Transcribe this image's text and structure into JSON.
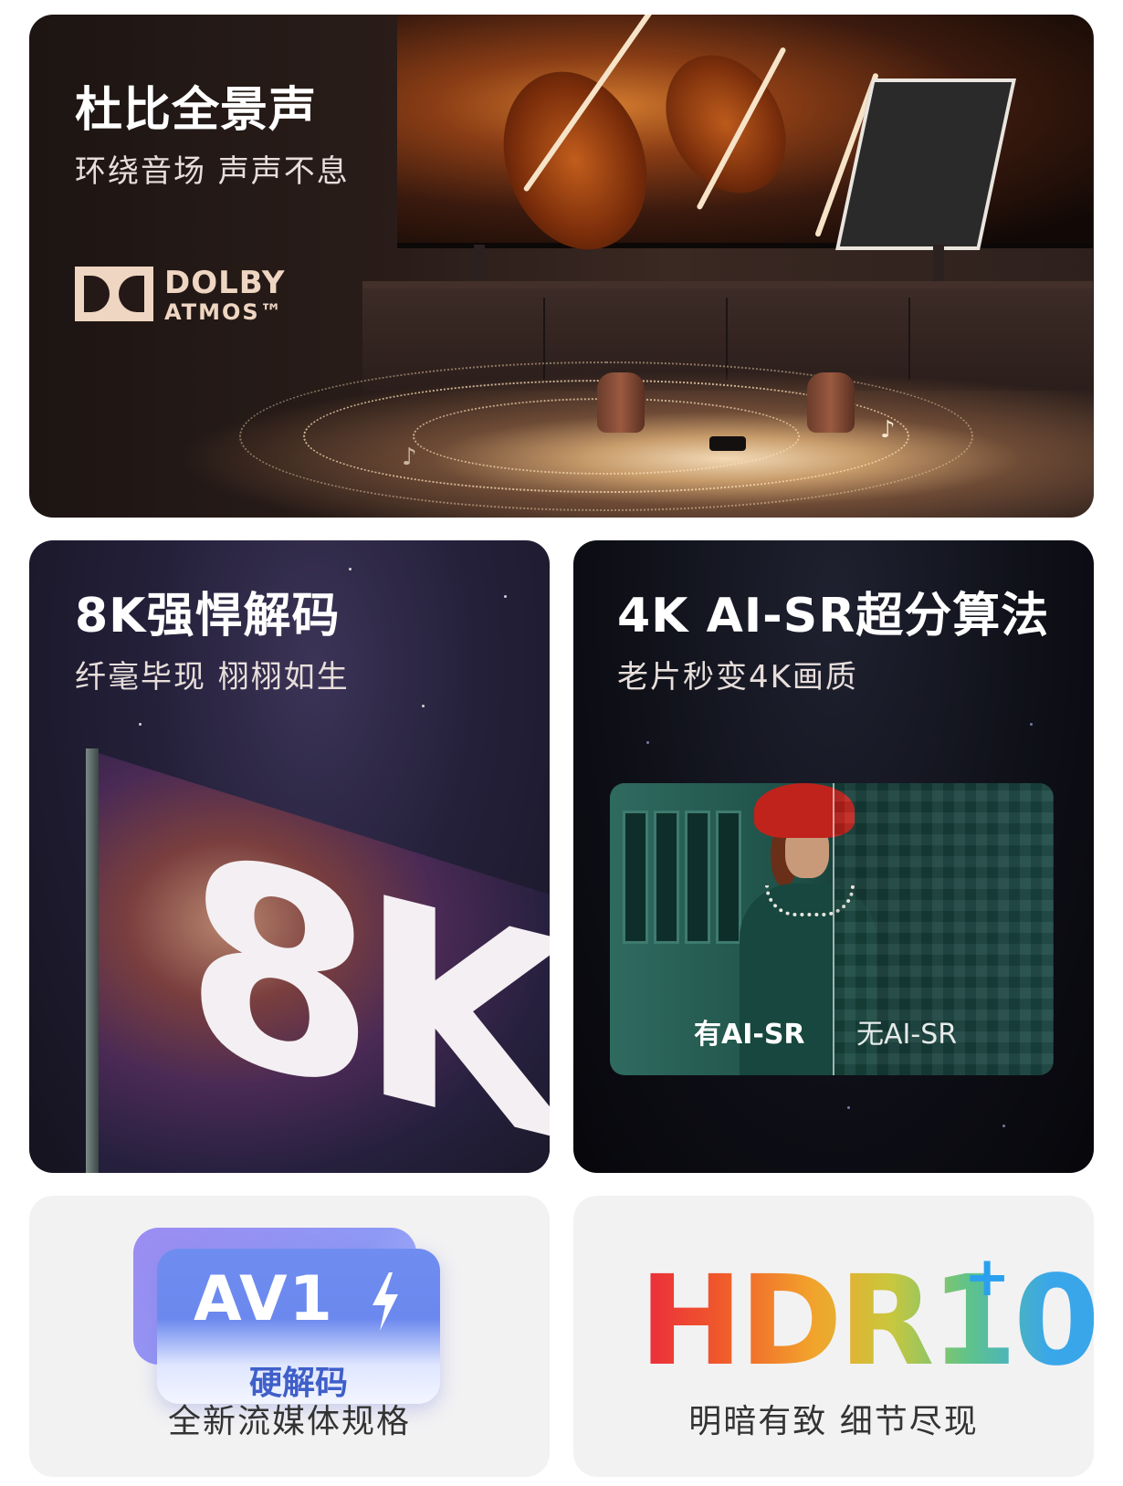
{
  "dolby": {
    "title": "杜比全景声",
    "subtitle": "环绕音场 声声不息",
    "logo_word1": "DOLBY",
    "logo_word2": "ATMOS™"
  },
  "decode8k": {
    "title": "8K强悍解码",
    "subtitle": "纤毫毕现 栩栩如生",
    "graphic_text": "8K"
  },
  "aisr": {
    "title": "4K AI-SR超分算法",
    "subtitle": "老片秒变4K画质",
    "label_with": "有AI-SR",
    "label_without": "无AI-SR"
  },
  "av1": {
    "badge_text": "AV1",
    "badge_sub": "硬解码",
    "caption": "全新流媒体规格"
  },
  "hdr": {
    "logo_text": "HDR10",
    "logo_plus": "+",
    "caption": "明暗有致 细节尽现"
  }
}
